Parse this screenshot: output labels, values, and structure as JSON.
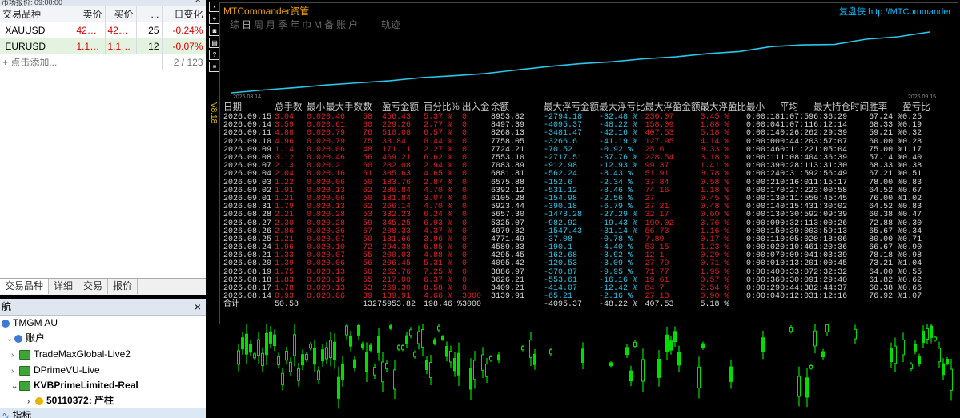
{
  "market_watch": {
    "header": "市场报价: 09:00:00",
    "columns": [
      "交易品种",
      "卖价",
      "买价",
      "...",
      "日变化"
    ],
    "rows": [
      {
        "symbol": "XAUUSD",
        "bid": "4282...",
        "ask": "4282...",
        "spread": "25",
        "change": "-0.24%"
      },
      {
        "symbol": "EURUSD",
        "bid": "1.15...",
        "ask": "1.15...",
        "spread": "12",
        "change": "-0.07%"
      }
    ],
    "add_label": "点击添加...",
    "count": "2 / 123",
    "tabs": [
      "交易品种",
      "详细",
      "交易",
      "报价"
    ]
  },
  "navigator": {
    "title": "航",
    "root": "TMGM AU",
    "accounts_label": "账户",
    "servers": [
      "TradeMaxGlobal-Live2",
      "DPrimeVU-Live",
      "KVBPrimeLimited-Real"
    ],
    "account": "50110372: 严柱",
    "indicators_label": "指标"
  },
  "chart": {
    "version_label": "V8.18",
    "panel": {
      "title": "MTCommander资管",
      "brand": "复盘侠",
      "url": "http://MTCommander",
      "tabs": [
        "综",
        "日",
        "周",
        "月",
        "季",
        "年",
        "巾",
        "M",
        "备",
        "账户"
      ],
      "track_label": "轨迹",
      "date_start": "2026.08.14",
      "date_end": "2026.09.15",
      "columns": [
        "日期",
        "总手数",
        "最小",
        "最大手数",
        "数",
        "盈亏金额",
        "百分比%",
        "出入金",
        "余额",
        "最大浮亏金额",
        "最大浮亏比",
        "最大浮盈金额",
        "最大浮盈比",
        "最小",
        "平均",
        "最大持仓时间",
        "胜率",
        "盈亏比"
      ],
      "rows": [
        [
          "2026.09.15",
          "3.04",
          "0.02",
          "0.46",
          "58",
          "456.43",
          "5.37 %",
          "0",
          "8953.82",
          "-2794.18",
          "-32.48 %",
          "236.07",
          "3.45 %",
          "0:00:18",
          "1:07:59",
          "6:36:29",
          "67.24 %",
          "0.25"
        ],
        [
          "2026.09.14",
          "3.59",
          "0.02",
          "0.61",
          "60",
          "229.26",
          "2.77 %",
          "0",
          "8497.39",
          "-4095.37",
          "-48.22 %",
          "158.09",
          "1.88 %",
          "0:00:04",
          "1:07:11",
          "6:12:14",
          "68.33 %",
          "0.19"
        ],
        [
          "2026.09.11",
          "4.88",
          "0.02",
          "0.79",
          "76",
          "510.08",
          "6.57 %",
          "0",
          "8268.13",
          "-3481.47",
          "-42.16 %",
          "407.53",
          "5.18 %",
          "0:00:14",
          "0:26:26",
          "2:29:39",
          "59.21 %",
          "0.32"
        ],
        [
          "2026.09.10",
          "4.96",
          "0.02",
          "0.79",
          "75",
          "33.84",
          "0.44 %",
          "0",
          "7758.05",
          "-3266.6",
          "-41.19 %",
          "127.95",
          "4.14 %",
          "0:00:00",
          "0:44:20",
          "3:57:07",
          "60.00 %",
          "0.28"
        ],
        [
          "2026.09.09",
          "1.14",
          "0.02",
          "0.06",
          "48",
          "171.11",
          "2.27 %",
          "0",
          "7724.21",
          "-70.52",
          "-0.92 %",
          "25.6",
          "0.33 %",
          "0:00:46",
          "0:11:22",
          "1:05:04",
          "75.00 %",
          "1.17"
        ],
        [
          "2026.09.08",
          "3.12",
          "0.02",
          "0.46",
          "56",
          "469.21",
          "6.62 %",
          "0",
          "7553.10",
          "-2717.51",
          "-37.76 %",
          "228.54",
          "3.18 %",
          "0:00:11",
          "1:08:40",
          "4:36:39",
          "57.14 %",
          "0.40"
        ],
        [
          "2026.09.07",
          "2.13",
          "0.02",
          "0.21",
          "60",
          "202.08",
          "2.94 %",
          "0",
          "7083.89",
          "-912.98",
          "-12.93 %",
          "99.37",
          "1.41 %",
          "0:00:39",
          "0:28:11",
          "3:31:30",
          "68.33 %",
          "0.38"
        ],
        [
          "2026.09.04",
          "2.04",
          "0.02",
          "0.16",
          "61",
          "305.63",
          "4.65 %",
          "0",
          "6881.81",
          "-562.24",
          "-8.43 %",
          "51.91",
          "0.78 %",
          "0:00:24",
          "0:31:59",
          "2:56:49",
          "67.21 %",
          "0.51"
        ],
        [
          "2026.09.03",
          "1.22",
          "0.02",
          "0.06",
          "50",
          "183.76",
          "2.87 %",
          "0",
          "6575.88",
          "-152.6",
          "-2.34 %",
          "37.84",
          "0.58 %",
          "0:00:21",
          "0:16:01",
          "1:15:17",
          "78.00 %",
          "0.83"
        ],
        [
          "2026.09.02",
          "1.91",
          "0.02",
          "0.13",
          "62",
          "286.84",
          "4.70 %",
          "0",
          "6392.12",
          "-531.12",
          "-8.46 %",
          "74.16",
          "1.18 %",
          "0:00:17",
          "0:27:22",
          "3:00:58",
          "64.52 %",
          "0.67"
        ],
        [
          "2026.09.01",
          "1.21",
          "0.02",
          "0.06",
          "50",
          "181.84",
          "3.07 %",
          "0",
          "6105.28",
          "-154.98",
          "-2.56 %",
          "27",
          "0.45 %",
          "0:00:13",
          "0:11:55",
          "0:45:45",
          "76.00 %",
          "1.02"
        ],
        [
          "2026.08.31",
          "1.79",
          "0.02",
          "0.13",
          "62",
          "266.14",
          "4.70 %",
          "0",
          "5923.44",
          "-390.18",
          "-6.79 %",
          "27.21",
          "0.48 %",
          "0:00:14",
          "0:15:43",
          "1:30:02",
          "64.52 %",
          "0.83"
        ],
        [
          "2026.08.28",
          "2.21",
          "0.02",
          "0.28",
          "53",
          "332.23",
          "6.24 %",
          "0",
          "5657.30",
          "-1473.28",
          "-27.29 %",
          "32.17",
          "0.60 %",
          "0:00:13",
          "0:30:59",
          "2:09:39",
          "60.38 %",
          "0.47"
        ],
        [
          "2026.08.27",
          "2.30",
          "0.02",
          "0.28",
          "59",
          "345.25",
          "6.93 %",
          "0",
          "5325.07",
          "-982.92",
          "-19.43 %",
          "190.02",
          "3.76 %",
          "0:00:09",
          "0:32:11",
          "3:00:26",
          "72.88 %",
          "0.30"
        ],
        [
          "2026.08.26",
          "2.86",
          "0.02",
          "0.36",
          "67",
          "208.33",
          "4.37 %",
          "0",
          "4979.82",
          "-1547.43",
          "-31.14 %",
          "56.73",
          "1.16 %",
          "0:00:15",
          "0:39:00",
          "3:59:13",
          "65.67 %",
          "0.34"
        ],
        [
          "2026.08.25",
          "1.21",
          "0.02",
          "0.07",
          "50",
          "181.66",
          "3.96 %",
          "0",
          "4771.49",
          "-37.08",
          "-0.78 %",
          "7.89",
          "0.17 %",
          "0:00:11",
          "0:05:02",
          "0:18:06",
          "80.00 %",
          "0.71"
        ],
        [
          "2026.08.24",
          "1.96",
          "0.02",
          "0.10",
          "72",
          "294.38",
          "6.85 %",
          "0",
          "4589.83",
          "-190.1",
          "-4.40 %",
          "53.15",
          "1.23 %",
          "0:00:02",
          "0:10:46",
          "1:20:36",
          "66.67 %",
          "0.90"
        ],
        [
          "2026.08.21",
          "1.33",
          "0.02",
          "0.07",
          "55",
          "200.03",
          "4.88 %",
          "0",
          "4295.45",
          "-162.68",
          "-3.92 %",
          "12.1",
          "0.29 %",
          "0:00:07",
          "0:09:04",
          "1:03:39",
          "78.18 %",
          "0.98"
        ],
        [
          "2026.08.20",
          "1.39",
          "0.02",
          "0.06",
          "56",
          "206.45",
          "5.31 %",
          "0",
          "4095.42",
          "-120.53",
          "-3.09 %",
          "27.79",
          "0.71 %",
          "0:00:01",
          "0:13:20",
          "1:00:45",
          "73.21 %",
          "1.04"
        ],
        [
          "2026.08.19",
          "1.75",
          "0.02",
          "0.13",
          "50",
          "262.76",
          "7.25 %",
          "0",
          "3886.97",
          "-370.87",
          "-9.95 %",
          "71.77",
          "1.95 %",
          "0:00:40",
          "0:33:07",
          "2:32:32",
          "64.00 %",
          "0.55"
        ],
        [
          "2026.08.18",
          "1.83",
          "0.02",
          "0.16",
          "55",
          "217.00",
          "6.37 %",
          "0",
          "3626.21",
          "-553.61",
          "-16.16 %",
          "19.61",
          "0.57 %",
          "0:00:36",
          "0:30:09",
          "1:29:40",
          "61.82 %",
          "0.62"
        ],
        [
          "2026.08.17",
          "1.78",
          "0.02",
          "0.13",
          "53",
          "269.30",
          "8.58 %",
          "0",
          "3409.21",
          "-414.07",
          "-12.42 %",
          "84.7",
          "2.54 %",
          "0:00:29",
          "0:44:38",
          "2:44:37",
          "60.38 %",
          "0.66"
        ],
        [
          "2026.08.14",
          "0.93",
          "0.02",
          "0.06",
          "39",
          "139.91",
          "4.66 %",
          "3000",
          "3139.91",
          "-65.21",
          "-2.16 %",
          "27.13",
          "0.90 %",
          "0:00:04",
          "0:12:03",
          "1:12:16",
          "76.92 %",
          "1.07"
        ]
      ],
      "total": [
        "合计",
        "50.58",
        "",
        "",
        "1327",
        "5953.82",
        "198.46 %",
        "3000",
        "",
        "-4095.37",
        "-48.22 %",
        "407.53",
        "5.18 %",
        "",
        "",
        "",
        "",
        ""
      ],
      "equity_curve": [
        3139.91,
        3409.21,
        3626.21,
        3886.97,
        4095.42,
        4295.45,
        4589.83,
        4771.49,
        4979.82,
        5325.07,
        5657.3,
        5923.44,
        6105.28,
        6392.12,
        6575.88,
        6881.81,
        7083.89,
        7553.1,
        7724.21,
        7758.05,
        8268.13,
        8497.39,
        8953.82
      ]
    },
    "colors": {
      "line": "#29c7e8",
      "red": "#e02020",
      "cyan": "#29c7e8",
      "bull": "#00e000"
    }
  }
}
